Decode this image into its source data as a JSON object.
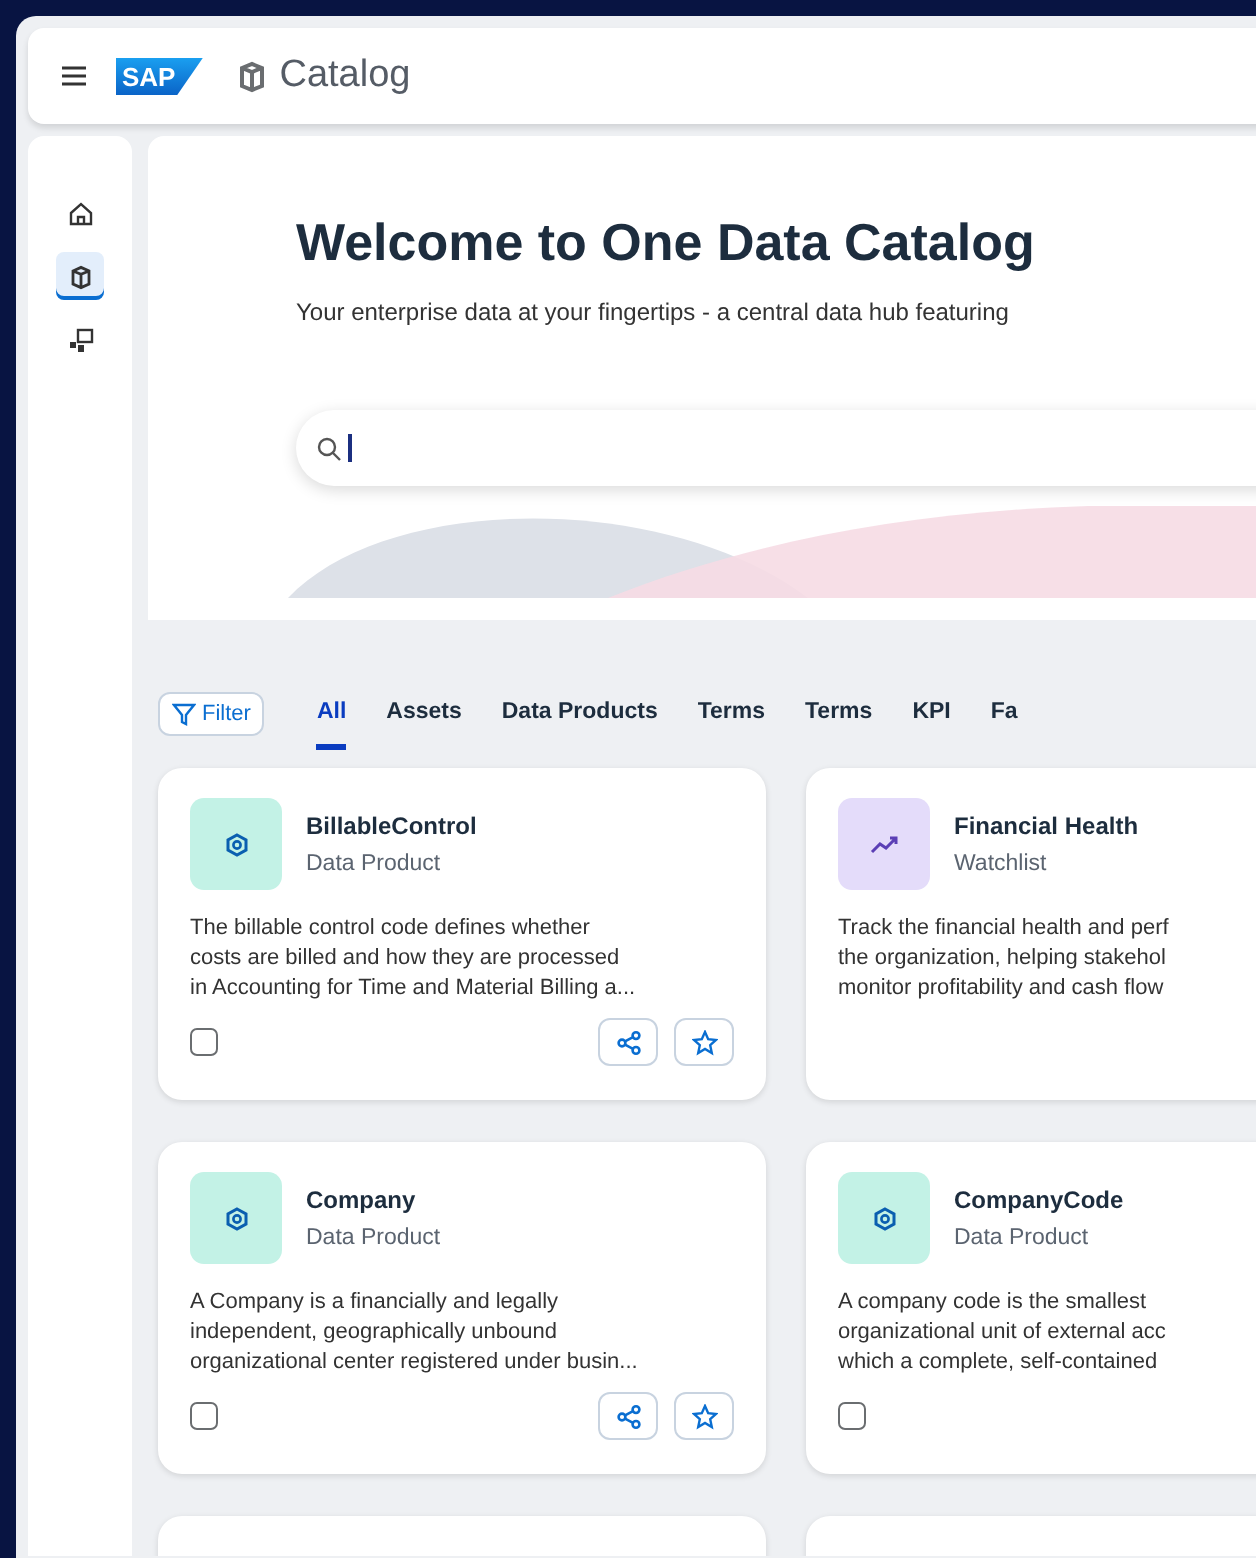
{
  "header": {
    "logo": "SAP",
    "title": "Catalog"
  },
  "sidebar": {
    "items": [
      {
        "selected": false
      },
      {
        "selected": true
      },
      {
        "selected": false
      }
    ]
  },
  "hero": {
    "title": "Welcome to One Data Catalog",
    "subtitle": "Your enterprise data at your fingertips - a central data hub featuring"
  },
  "filter_button": "Filter",
  "tabs": [
    {
      "label": "All",
      "selected": true
    },
    {
      "label": "Assets",
      "selected": false
    },
    {
      "label": "Data Products",
      "selected": false
    },
    {
      "label": "Terms",
      "selected": false
    },
    {
      "label": "Terms",
      "selected": false
    },
    {
      "label": "KPI",
      "selected": false
    },
    {
      "label": "Fa",
      "selected": false
    }
  ],
  "cards": [
    {
      "kind": "data-product",
      "title": "BillableControl",
      "type": "Data Product",
      "description": [
        "The billable control code defines whether",
        "costs are billed and how they are processed",
        "in Accounting for Time and Material Billing a..."
      ],
      "footer": [
        {
          "kind": "checkbox",
          "checked": false
        },
        {
          "kind": "share"
        },
        {
          "kind": "favorite"
        }
      ]
    },
    {
      "kind": "watchlist",
      "title": "Financial Health",
      "type": "Watchlist",
      "description": [
        "Track the financial health and perf",
        "the organization, helping stakehol",
        "monitor profitability and cash flow"
      ]
    },
    {
      "kind": "data-product",
      "title": "Company",
      "type": "Data Product",
      "description": [
        "A Company is a financially and legally",
        "independent, geographically unbound",
        "organizational center registered under busin..."
      ],
      "footer": [
        {
          "kind": "checkbox",
          "checked": false
        },
        {
          "kind": "share"
        },
        {
          "kind": "favorite"
        }
      ]
    },
    {
      "kind": "data-product",
      "title": "CompanyCode",
      "type": "Data Product",
      "description": [
        "A company code is the smallest",
        "organizational unit of external acc",
        "which a complete, self-contained"
      ],
      "footer": [
        {
          "kind": "checkbox",
          "checked": false
        }
      ]
    }
  ]
}
